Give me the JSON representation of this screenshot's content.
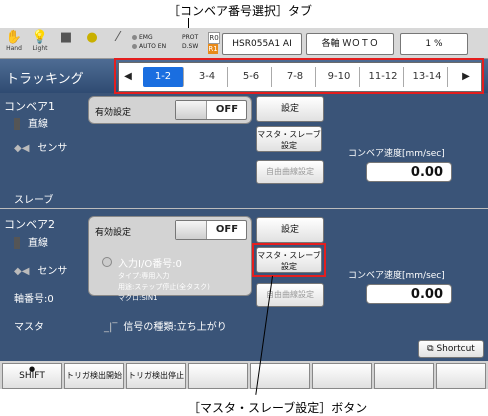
{
  "callouts": {
    "top": "［コンベア番号選択］タブ",
    "bottom": "［マスタ・スレーブ設定］ボタン"
  },
  "statusbar": {
    "icons": [
      {
        "name": "hand-icon",
        "label": "Hand"
      },
      {
        "name": "light-bulb-icon",
        "label": "Light"
      },
      {
        "name": "square-icon",
        "label": ""
      },
      {
        "name": "bulb-icon",
        "label": ""
      },
      {
        "name": "wrench-icon",
        "label": ""
      }
    ],
    "emg": "EMG",
    "auto": "AUTO EN",
    "prot": "PROT",
    "dsw": "D.SW",
    "r0": "R0",
    "r1": "R1",
    "robot": "HSR055A1 AI",
    "axis": "各軸 ＷＯＴＯ",
    "speed": "1 %"
  },
  "titlebar": {
    "title": "トラッキング",
    "tabs": [
      "1-2",
      "3-4",
      "5-6",
      "7-8",
      "9-10",
      "11-12",
      "13-14"
    ],
    "active_tab": "1-2"
  },
  "conveyor1": {
    "title": "コンベア1",
    "type": "直線",
    "sensor": "センサ",
    "role": "スレーブ",
    "enable_label": "有効設定",
    "toggle": "OFF",
    "settings_btn": "設定",
    "ms_btn": "マスタ・スレーブ\n設定",
    "curve_btn": "自由曲線設定",
    "speed_label": "コンベア速度[mm/sec]",
    "speed_value": "0.00"
  },
  "conveyor2": {
    "title": "コンベア2",
    "type": "直線",
    "sensor": "センサ",
    "axis_no": "軸番号:0",
    "role": "マスタ",
    "enable_label": "有効設定",
    "toggle": "OFF",
    "settings_btn": "設定",
    "ms_btn": "マスタ・スレーブ\n設定",
    "curve_btn": "自由曲線設定",
    "input_io": "入力I/O番号:0",
    "io_type": "タイプ:専用入力",
    "io_use": "用途:ステップ停止(全タスク)",
    "io_macro": "マクロ:SIN1",
    "signal_kind": "信号の種類:立ち上がり",
    "speed_label": "コンベア速度[mm/sec]",
    "speed_value": "0.00"
  },
  "shortcut": "Shortcut",
  "fkeys": [
    "SHIFT",
    "トリガ検出開始",
    "トリガ検出停止",
    "",
    "",
    "",
    "",
    ""
  ]
}
